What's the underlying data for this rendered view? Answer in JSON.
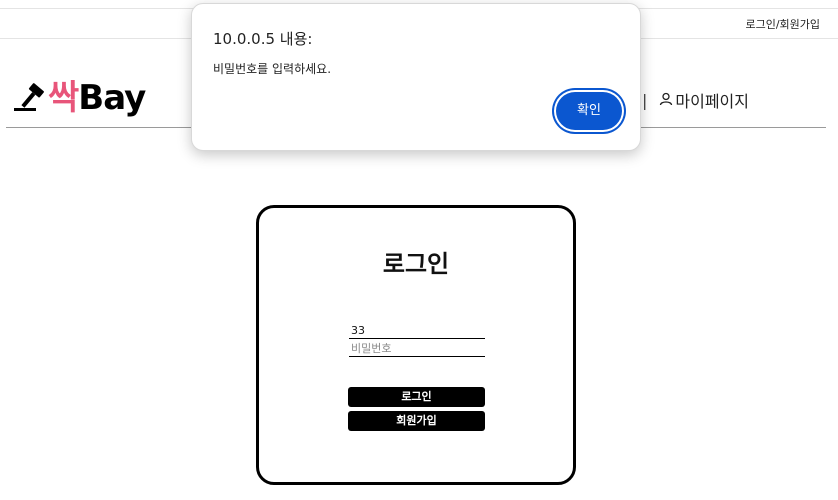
{
  "topbar": {
    "auth_links": "로그인/회원가입"
  },
  "header": {
    "logo_ssak": "싹",
    "logo_bay": "Bay",
    "nav_separator": "|",
    "mypage_label": "마이페이지"
  },
  "login": {
    "title": "로그인",
    "id_value": "33",
    "password_placeholder": "비밀번호",
    "login_button": "로그인",
    "signup_button": "회원가입"
  },
  "dialog": {
    "title": "10.0.0.5 내용:",
    "message": "비밀번호를 입력하세요.",
    "ok_button": "확인"
  },
  "colors": {
    "brand_pink": "#e8557a",
    "dialog_button_blue": "#0b57d0",
    "button_black": "#000000"
  },
  "icons": {
    "logo_icon": "gavel-icon",
    "mypage_icon": "user-icon"
  }
}
